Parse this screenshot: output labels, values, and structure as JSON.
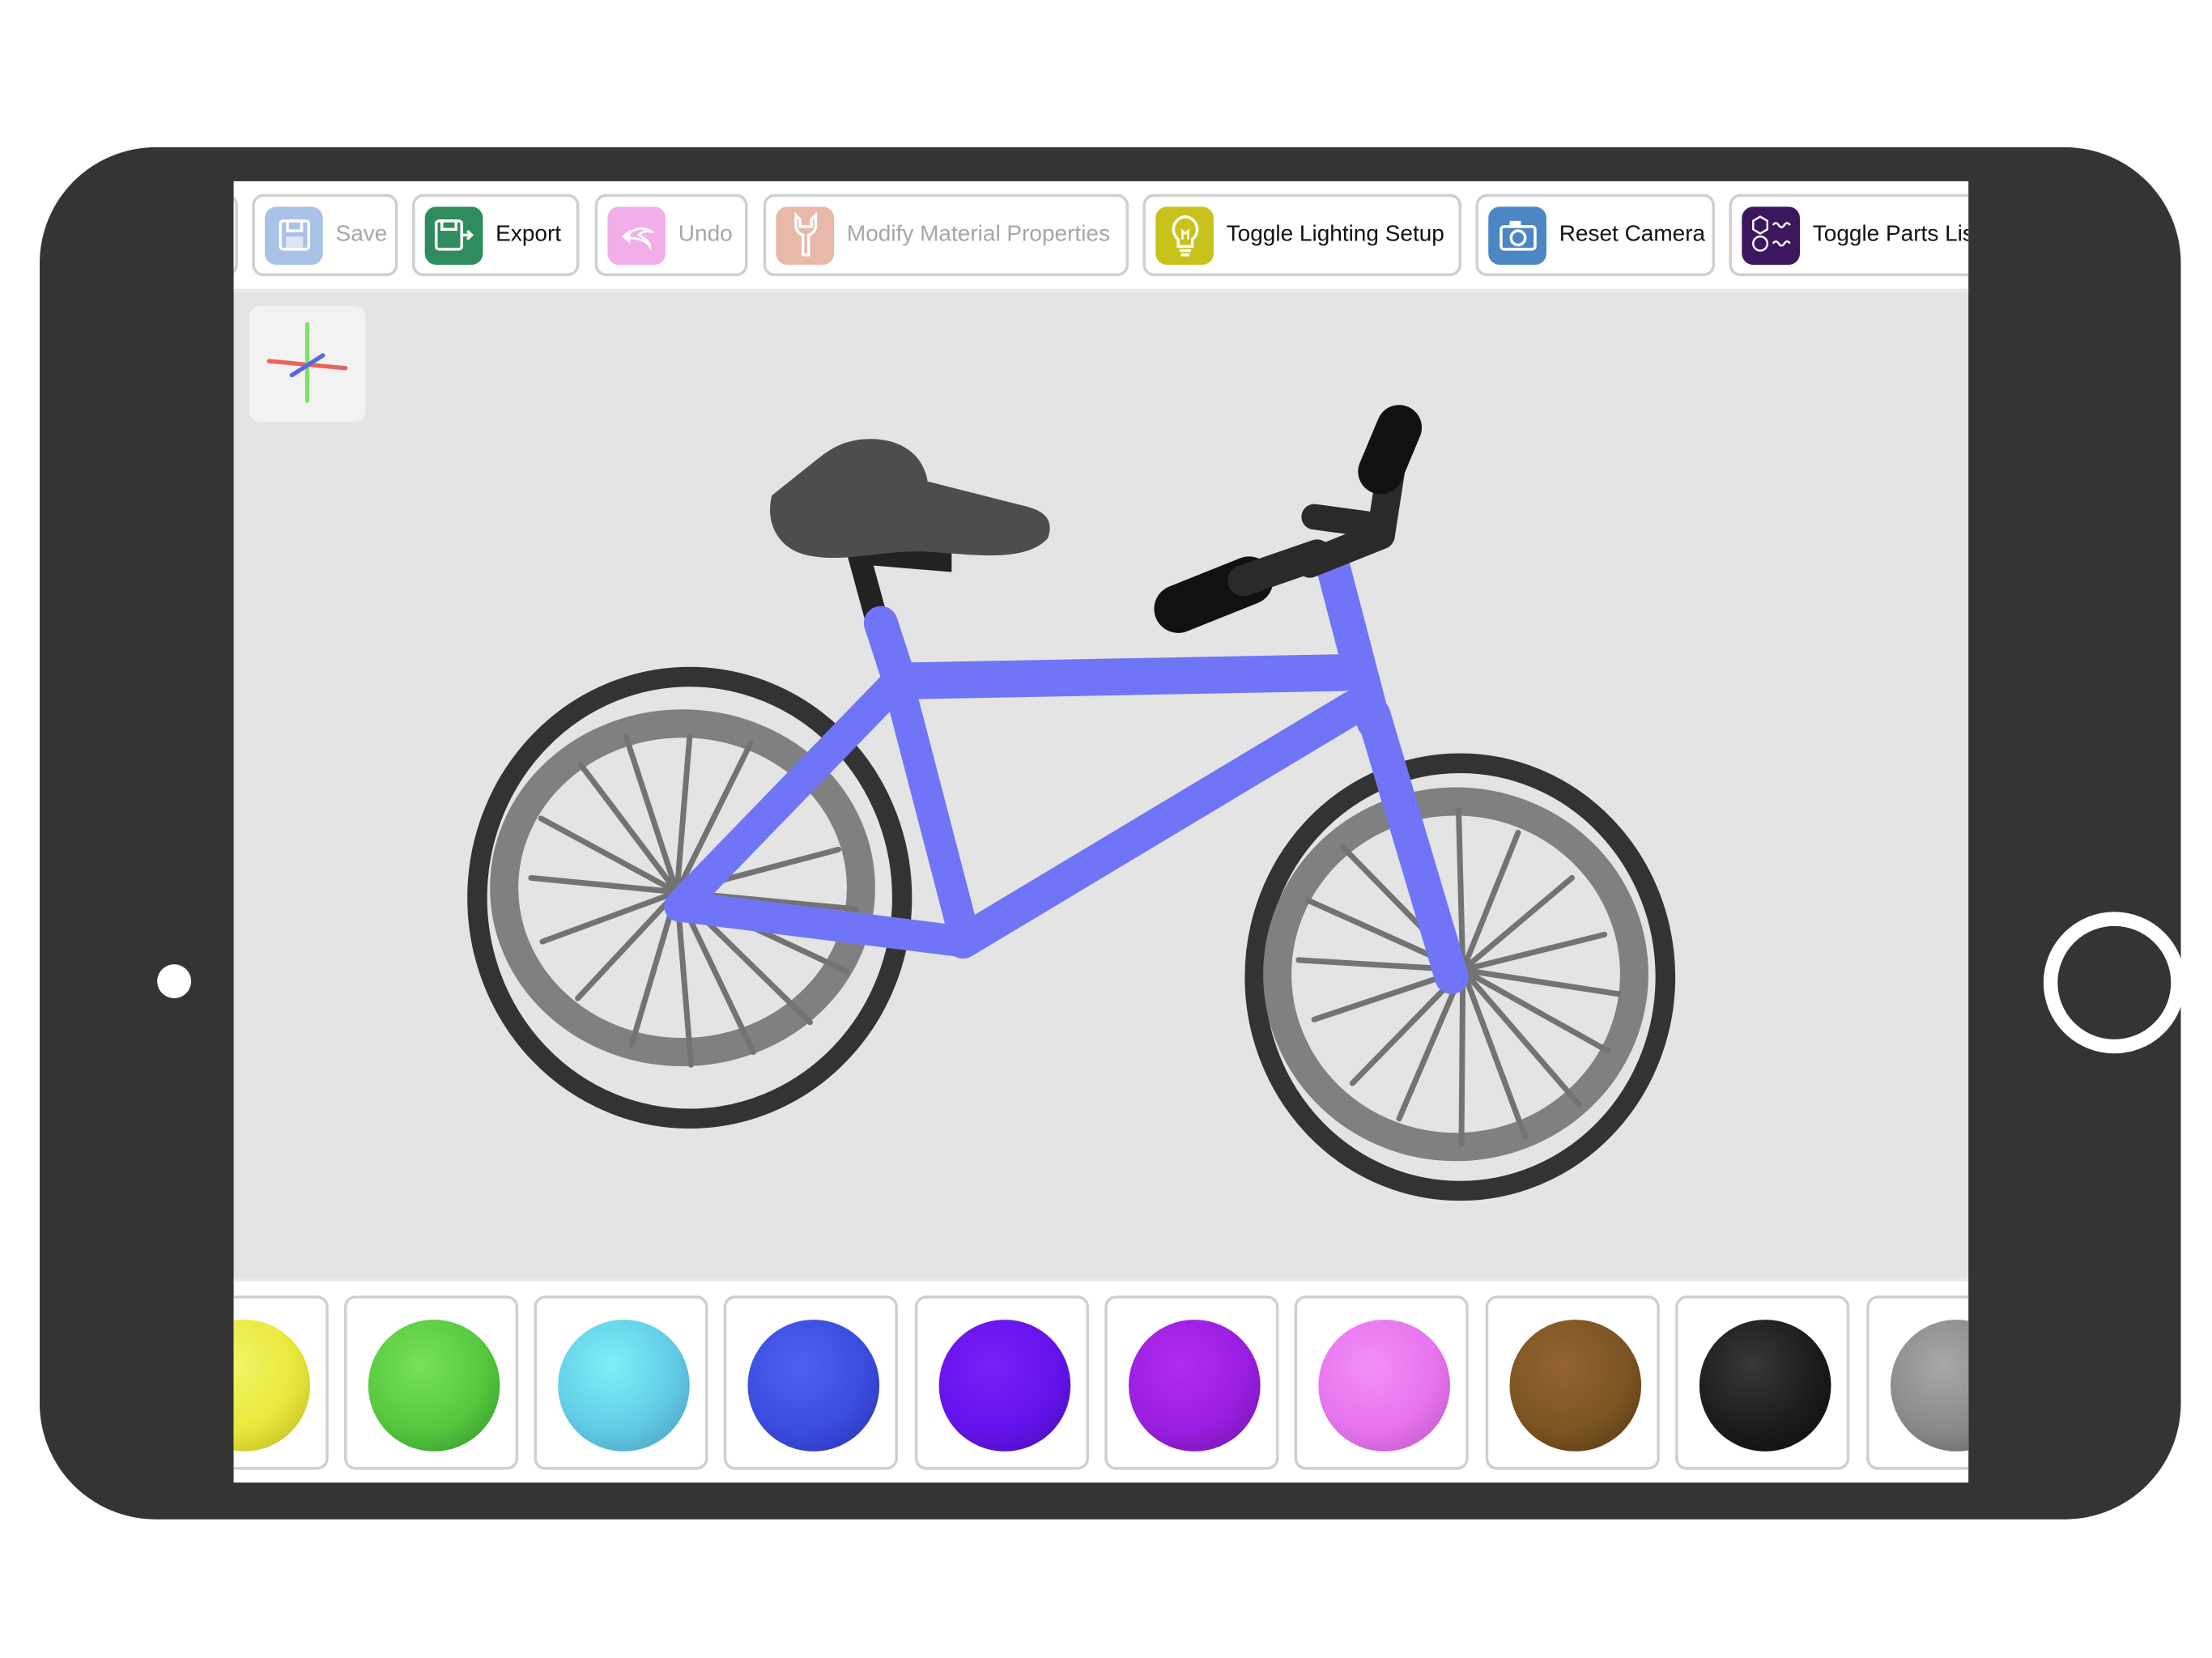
{
  "toolbar": {
    "save_label": "Save",
    "export_label": "Export",
    "undo_label": "Undo",
    "modify_label": "Modify Material Properties",
    "lighting_label": "Toggle Lighting Setup",
    "reset_camera_label": "Reset Camera",
    "parts_list_label": "Toggle Parts List",
    "icons": {
      "save": "floppy-disk-icon",
      "export": "export-disk-icon",
      "undo": "undo-arrow-icon",
      "modify": "wrench-icon",
      "lighting": "lightbulb-icon",
      "reset_camera": "camera-icon",
      "parts_list": "parts-list-icon"
    },
    "icon_colors": {
      "save": "#a8c2e8",
      "export": "#2f8c5c",
      "undo": "#f2aee8",
      "modify": "#e8b8a8",
      "lighting": "#c9c21c",
      "reset_camera": "#4c86c4",
      "parts_list": "#3c1760"
    },
    "disabled": [
      "save",
      "undo",
      "modify"
    ]
  },
  "viewport": {
    "background": "#e4e4e4",
    "axes_icon": "xyz-axes-icon",
    "model": "bicycle",
    "frame_color": "#7075f7",
    "tire_color": "#333333",
    "rim_color": "#808080",
    "saddle_color": "#4d4d4d",
    "handlebar_color": "#111111"
  },
  "palette": {
    "colors": [
      {
        "name": "yellow",
        "hex": "#e8e83a"
      },
      {
        "name": "green",
        "hex": "#56c83e"
      },
      {
        "name": "light-blue",
        "hex": "#62cbe6"
      },
      {
        "name": "blue",
        "hex": "#3b4ce0"
      },
      {
        "name": "indigo",
        "hex": "#6512ec"
      },
      {
        "name": "violet",
        "hex": "#9a1ee0"
      },
      {
        "name": "pink",
        "hex": "#e774ec"
      },
      {
        "name": "brown",
        "hex": "#7c5522"
      },
      {
        "name": "black",
        "hex": "#1c1c1c"
      },
      {
        "name": "gray",
        "hex": "#8a8a8a"
      }
    ]
  }
}
